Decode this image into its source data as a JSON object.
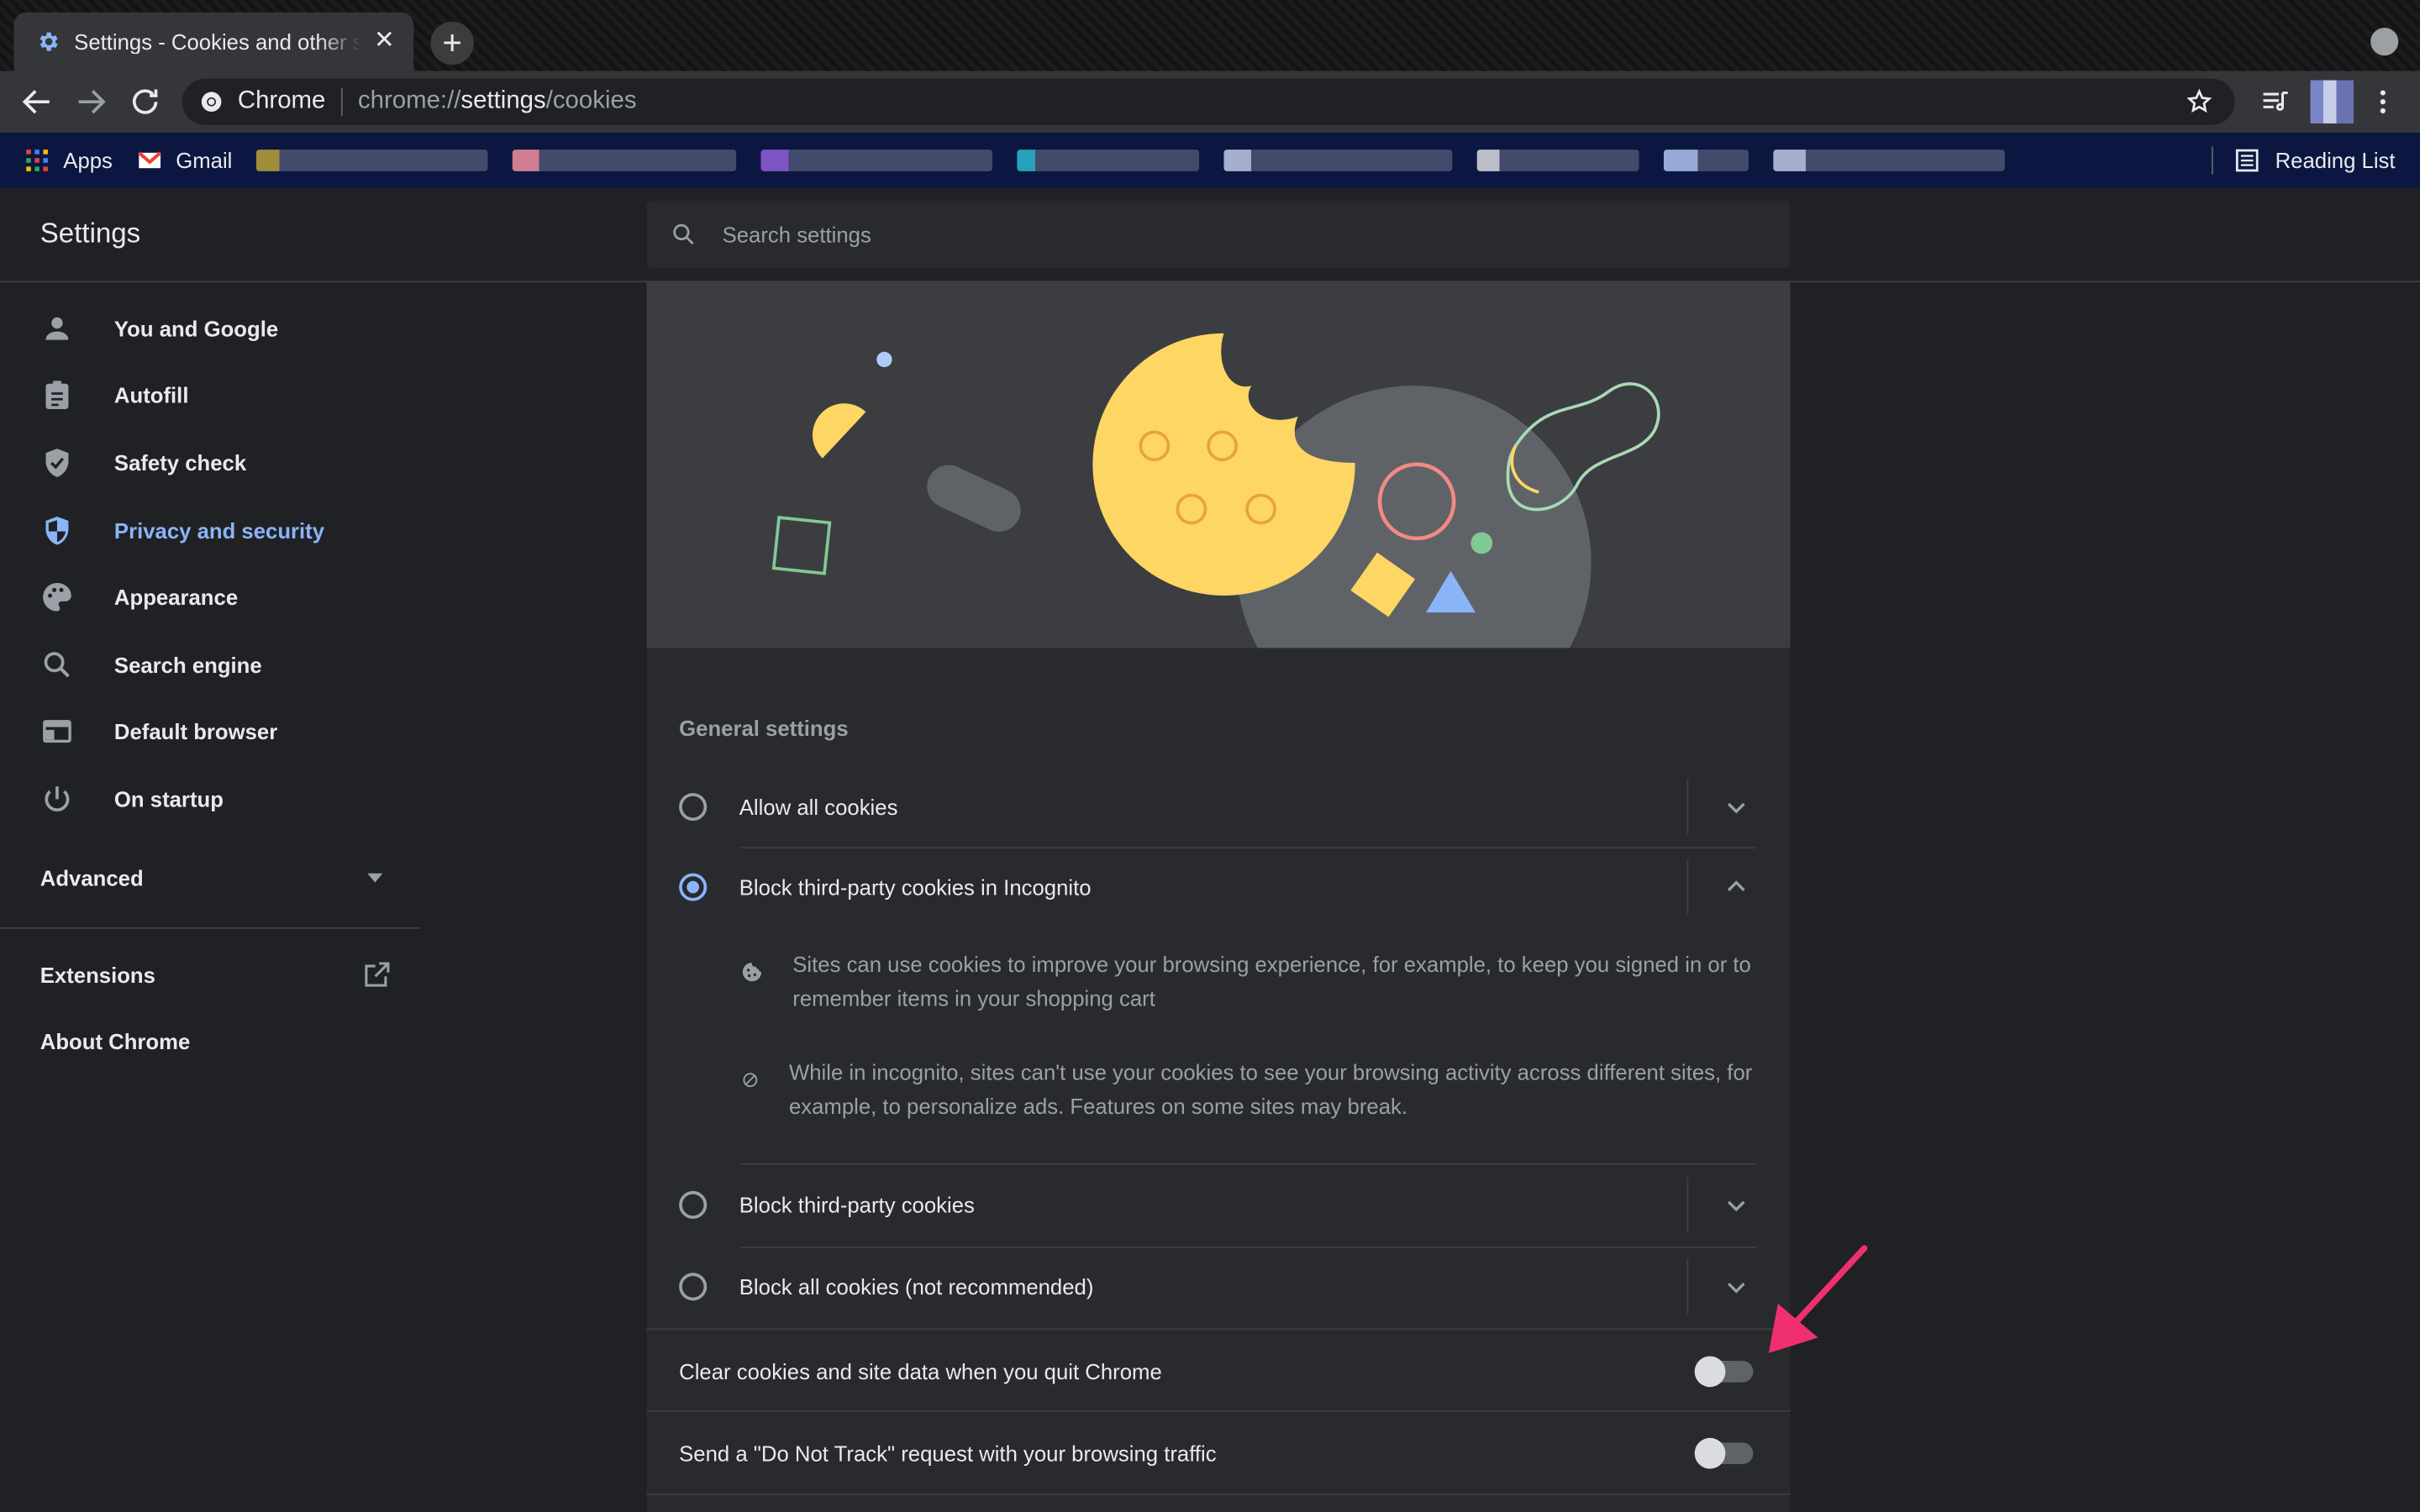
{
  "browser": {
    "tab_title": "Settings - Cookies and other site data",
    "omnibox_chip": "Chrome",
    "url_prefix": "chrome://",
    "url_host": "settings",
    "url_path": "/cookies"
  },
  "bookmarks": {
    "apps": "Apps",
    "gmail": "Gmail",
    "reading_list": "Reading List"
  },
  "settings": {
    "title": "Settings",
    "search_placeholder": "Search settings"
  },
  "sidebar": {
    "items": [
      {
        "label": "You and Google",
        "icon": "person-icon"
      },
      {
        "label": "Autofill",
        "icon": "clipboard-icon"
      },
      {
        "label": "Safety check",
        "icon": "shield-check-icon"
      },
      {
        "label": "Privacy and security",
        "icon": "shield-half-icon"
      },
      {
        "label": "Appearance",
        "icon": "palette-icon"
      },
      {
        "label": "Search engine",
        "icon": "search-icon"
      },
      {
        "label": "Default browser",
        "icon": "browser-window-icon"
      },
      {
        "label": "On startup",
        "icon": "power-icon"
      }
    ],
    "advanced": "Advanced",
    "extensions": "Extensions",
    "about": "About Chrome"
  },
  "cookies": {
    "section_label": "General settings",
    "options": [
      {
        "label": "Allow all cookies",
        "selected": false
      },
      {
        "label": "Block third-party cookies in Incognito",
        "selected": true
      },
      {
        "label": "Block third-party cookies",
        "selected": false
      },
      {
        "label": "Block all cookies (not recommended)",
        "selected": false
      }
    ],
    "details": [
      {
        "icon": "cookie-icon",
        "text": "Sites can use cookies to improve your browsing experience, for example, to keep you signed in or to remember items in your shopping cart"
      },
      {
        "icon": "block-icon",
        "text": "While in incognito, sites can't use your cookies to see your browsing activity across different sites, for example, to personalize ads. Features on some sites may break."
      }
    ],
    "toggles": [
      {
        "label": "Clear cookies and site data when you quit Chrome",
        "on": false
      },
      {
        "label": "Send a \"Do Not Track\" request with your browsing traffic",
        "on": false
      }
    ]
  },
  "colors": {
    "accent": "#8ab4f8",
    "annotation_arrow": "#f0306e",
    "cookie": "#fdd663"
  }
}
